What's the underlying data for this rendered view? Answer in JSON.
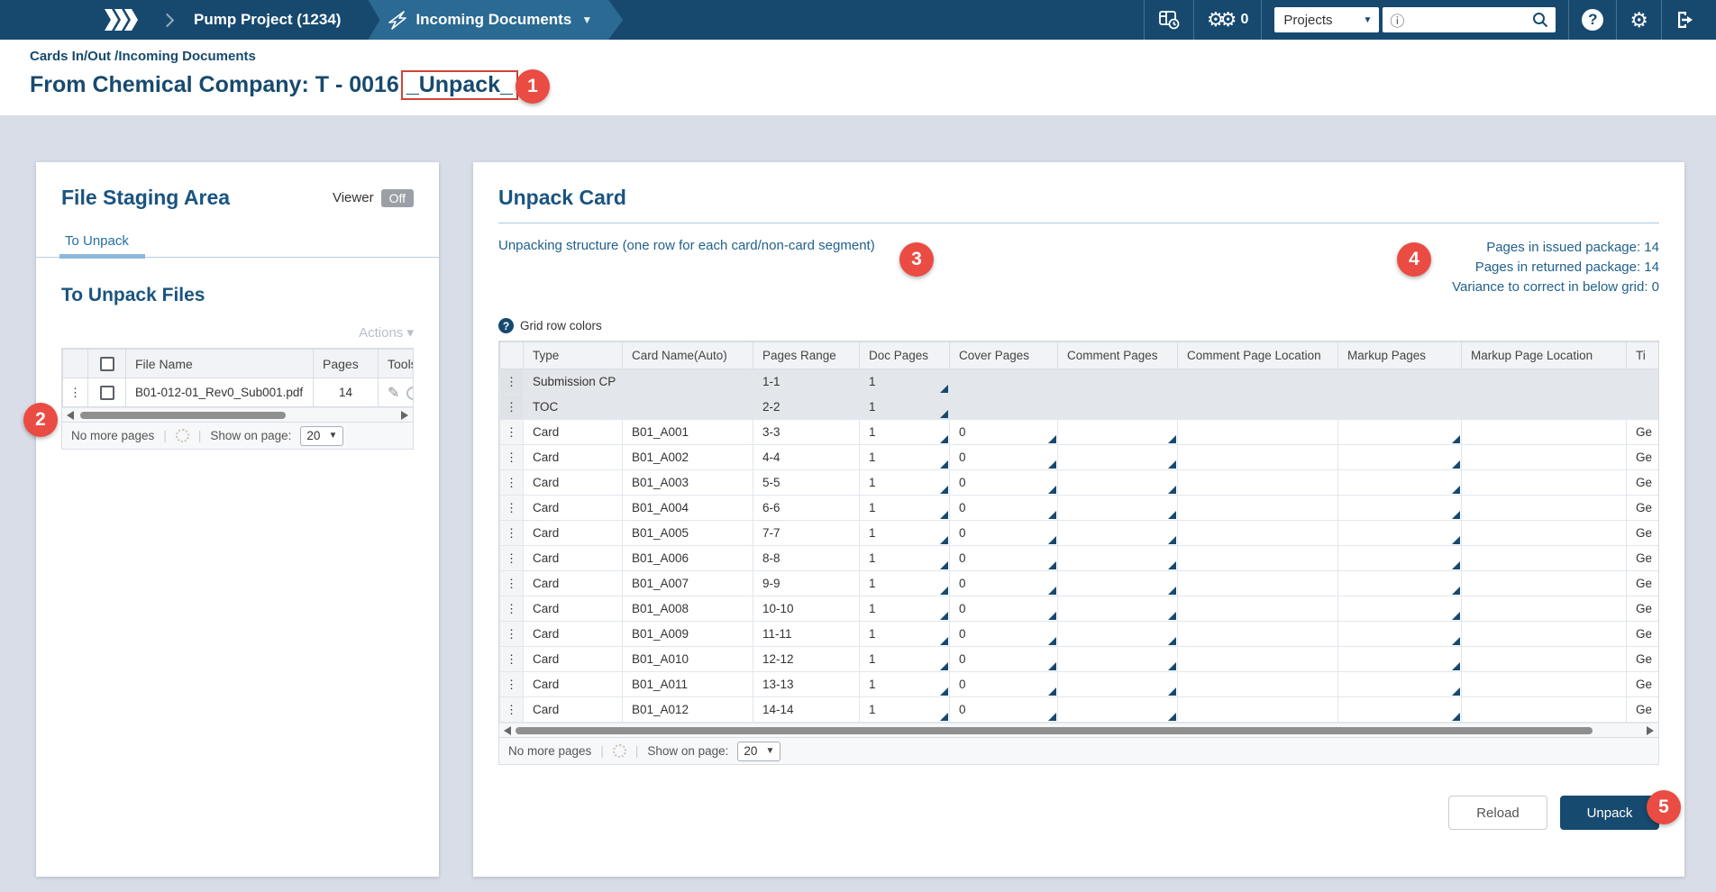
{
  "topbar": {
    "project_tab": "Pump Project (1234)",
    "module_tab": "Incoming Documents",
    "gear_count": "0",
    "projects_select": "Projects",
    "search_value": ""
  },
  "header": {
    "breadcrumb": "Cards In/Out /Incoming Documents",
    "title_prefix": "From Chemical Company: T - 0016",
    "title_highlight": "_Unpack_"
  },
  "annotations": {
    "s1": "1",
    "s2": "2",
    "s3": "3",
    "s4": "4",
    "s5": "5"
  },
  "staging": {
    "heading": "File Staging Area",
    "viewer_label": "Viewer",
    "viewer_state": "Off",
    "tab": "To Unpack",
    "files_heading": "To Unpack Files",
    "actions_label": "Actions",
    "table": {
      "columns": [
        "File Name",
        "Pages",
        "Tools"
      ],
      "rows": [
        {
          "file_name": "B01-012-01_Rev0_Sub001.pdf",
          "pages": "14"
        }
      ]
    },
    "pager": {
      "status": "No more pages",
      "show_label": "Show on page:",
      "page_size": "20"
    }
  },
  "unpack": {
    "heading": "Unpack Card",
    "structure_label": "Unpacking structure (one row for each card/non-card segment)",
    "summary": [
      "Pages in issued package: 14",
      "Pages in returned package: 14",
      "Variance to correct in below grid: 0"
    ],
    "grid_colors_label": "Grid row colors",
    "grid": {
      "columns": [
        {
          "key": "type",
          "label": "Type"
        },
        {
          "key": "card_name",
          "label": "Card Name(Auto)"
        },
        {
          "key": "pages_range",
          "label": "Pages Range"
        },
        {
          "key": "doc_pages",
          "label": "Doc Pages"
        },
        {
          "key": "cover_pages",
          "label": "Cover Pages"
        },
        {
          "key": "comment_pages",
          "label": "Comment Pages"
        },
        {
          "key": "comment_page_location",
          "label": "Comment Page Location"
        },
        {
          "key": "markup_pages",
          "label": "Markup Pages"
        },
        {
          "key": "markup_page_location",
          "label": "Markup Page Location"
        },
        {
          "key": "title",
          "label": "Ti"
        }
      ],
      "rows": [
        {
          "type": "Submission CP",
          "card_name": "",
          "pages_range": "1-1",
          "doc_pages": "1",
          "cover_pages": "",
          "comment_pages": "",
          "comment_page_location": "",
          "markup_pages": "",
          "markup_page_location": "",
          "title": "",
          "shaded": true,
          "editable": [
            "doc_pages"
          ]
        },
        {
          "type": "TOC",
          "card_name": "",
          "pages_range": "2-2",
          "doc_pages": "1",
          "cover_pages": "",
          "comment_pages": "",
          "comment_page_location": "",
          "markup_pages": "",
          "markup_page_location": "",
          "title": "",
          "shaded": true,
          "editable": [
            "doc_pages"
          ]
        },
        {
          "type": "Card",
          "card_name": "B01_A001",
          "pages_range": "3-3",
          "doc_pages": "1",
          "cover_pages": "0",
          "comment_pages": "",
          "comment_page_location": "",
          "markup_pages": "",
          "markup_page_location": "",
          "title": "Ge",
          "shaded": false,
          "editable": [
            "doc_pages",
            "cover_pages",
            "comment_pages",
            "markup_pages"
          ]
        },
        {
          "type": "Card",
          "card_name": "B01_A002",
          "pages_range": "4-4",
          "doc_pages": "1",
          "cover_pages": "0",
          "comment_pages": "",
          "comment_page_location": "",
          "markup_pages": "",
          "markup_page_location": "",
          "title": "Ge",
          "shaded": false,
          "editable": [
            "doc_pages",
            "cover_pages",
            "comment_pages",
            "markup_pages"
          ]
        },
        {
          "type": "Card",
          "card_name": "B01_A003",
          "pages_range": "5-5",
          "doc_pages": "1",
          "cover_pages": "0",
          "comment_pages": "",
          "comment_page_location": "",
          "markup_pages": "",
          "markup_page_location": "",
          "title": "Ge",
          "shaded": false,
          "editable": [
            "doc_pages",
            "cover_pages",
            "comment_pages",
            "markup_pages"
          ]
        },
        {
          "type": "Card",
          "card_name": "B01_A004",
          "pages_range": "6-6",
          "doc_pages": "1",
          "cover_pages": "0",
          "comment_pages": "",
          "comment_page_location": "",
          "markup_pages": "",
          "markup_page_location": "",
          "title": "Ge",
          "shaded": false,
          "editable": [
            "doc_pages",
            "cover_pages",
            "comment_pages",
            "markup_pages"
          ]
        },
        {
          "type": "Card",
          "card_name": "B01_A005",
          "pages_range": "7-7",
          "doc_pages": "1",
          "cover_pages": "0",
          "comment_pages": "",
          "comment_page_location": "",
          "markup_pages": "",
          "markup_page_location": "",
          "title": "Ge",
          "shaded": false,
          "editable": [
            "doc_pages",
            "cover_pages",
            "comment_pages",
            "markup_pages"
          ]
        },
        {
          "type": "Card",
          "card_name": "B01_A006",
          "pages_range": "8-8",
          "doc_pages": "1",
          "cover_pages": "0",
          "comment_pages": "",
          "comment_page_location": "",
          "markup_pages": "",
          "markup_page_location": "",
          "title": "Ge",
          "shaded": false,
          "editable": [
            "doc_pages",
            "cover_pages",
            "comment_pages",
            "markup_pages"
          ]
        },
        {
          "type": "Card",
          "card_name": "B01_A007",
          "pages_range": "9-9",
          "doc_pages": "1",
          "cover_pages": "0",
          "comment_pages": "",
          "comment_page_location": "",
          "markup_pages": "",
          "markup_page_location": "",
          "title": "Ge",
          "shaded": false,
          "editable": [
            "doc_pages",
            "cover_pages",
            "comment_pages",
            "markup_pages"
          ]
        },
        {
          "type": "Card",
          "card_name": "B01_A008",
          "pages_range": "10-10",
          "doc_pages": "1",
          "cover_pages": "0",
          "comment_pages": "",
          "comment_page_location": "",
          "markup_pages": "",
          "markup_page_location": "",
          "title": "Ge",
          "shaded": false,
          "editable": [
            "doc_pages",
            "cover_pages",
            "comment_pages",
            "markup_pages"
          ]
        },
        {
          "type": "Card",
          "card_name": "B01_A009",
          "pages_range": "11-11",
          "doc_pages": "1",
          "cover_pages": "0",
          "comment_pages": "",
          "comment_page_location": "",
          "markup_pages": "",
          "markup_page_location": "",
          "title": "Ge",
          "shaded": false,
          "editable": [
            "doc_pages",
            "cover_pages",
            "comment_pages",
            "markup_pages"
          ]
        },
        {
          "type": "Card",
          "card_name": "B01_A010",
          "pages_range": "12-12",
          "doc_pages": "1",
          "cover_pages": "0",
          "comment_pages": "",
          "comment_page_location": "",
          "markup_pages": "",
          "markup_page_location": "",
          "title": "Ge",
          "shaded": false,
          "editable": [
            "doc_pages",
            "cover_pages",
            "comment_pages",
            "markup_pages"
          ]
        },
        {
          "type": "Card",
          "card_name": "B01_A011",
          "pages_range": "13-13",
          "doc_pages": "1",
          "cover_pages": "0",
          "comment_pages": "",
          "comment_page_location": "",
          "markup_pages": "",
          "markup_page_location": "",
          "title": "Ge",
          "shaded": false,
          "editable": [
            "doc_pages",
            "cover_pages",
            "comment_pages",
            "markup_pages"
          ]
        },
        {
          "type": "Card",
          "card_name": "B01_A012",
          "pages_range": "14-14",
          "doc_pages": "1",
          "cover_pages": "0",
          "comment_pages": "",
          "comment_page_location": "",
          "markup_pages": "",
          "markup_page_location": "",
          "title": "Ge",
          "shaded": false,
          "editable": [
            "doc_pages",
            "cover_pages",
            "comment_pages",
            "markup_pages"
          ]
        }
      ]
    },
    "pager": {
      "status": "No more pages",
      "show_label": "Show on page:",
      "page_size": "20"
    },
    "reload_button": "Reload",
    "unpack_button": "Unpack"
  },
  "colors": {
    "topbar": "#17496F",
    "ribbon": "#2A6A93",
    "accent_red": "#EA4B42",
    "heading_blue": "#1A5480",
    "primary_button": "#174A6F"
  }
}
